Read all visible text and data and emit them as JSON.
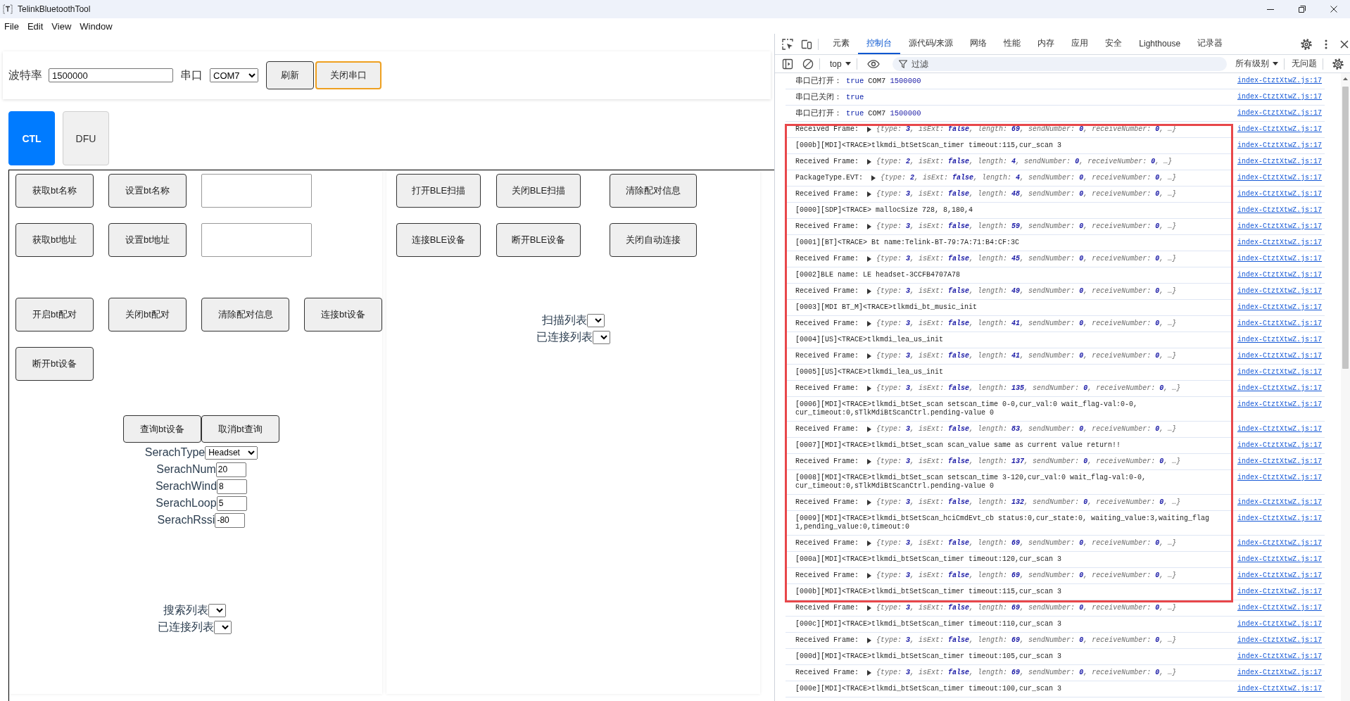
{
  "window": {
    "title": "TelinkBluetoothTool"
  },
  "menu": [
    "File",
    "Edit",
    "View",
    "Window"
  ],
  "serial_bar": {
    "baud_label": "波特率",
    "baud_value": "1500000",
    "port_label": "串口",
    "port_value": "COM7",
    "buttons": [
      {
        "label": "刷新",
        "focused": false
      },
      {
        "label": "关闭串口",
        "focused": true
      }
    ]
  },
  "tabs": [
    {
      "label": "CTL",
      "selected": true
    },
    {
      "label": "DFU",
      "selected": false
    }
  ],
  "bt_panel": {
    "rows": [
      [
        {
          "kind": "button",
          "label": "获取bt名称"
        },
        {
          "kind": "button",
          "label": "设置bt名称"
        },
        {
          "kind": "input"
        }
      ],
      [
        {
          "kind": "button",
          "label": "获取bt地址"
        },
        {
          "kind": "button",
          "label": "设置bt地址"
        },
        {
          "kind": "input"
        }
      ],
      [
        {
          "kind": "button",
          "label": "开启bt配对"
        },
        {
          "kind": "button",
          "label": "关闭bt配对"
        },
        {
          "kind": "button",
          "label": "清除配对信息"
        },
        {
          "kind": "button",
          "label": "连接bt设备"
        }
      ],
      [
        {
          "kind": "button",
          "label": "断开bt设备"
        }
      ]
    ],
    "query_buttons": [
      "查询bt设备",
      "取消bt查询"
    ],
    "search_params": [
      {
        "kind": "select",
        "label": "SerachType",
        "value": "Headset"
      },
      {
        "kind": "input",
        "label": "SerachNum",
        "value": "20"
      },
      {
        "kind": "input",
        "label": "SerachWind",
        "value": "8"
      },
      {
        "kind": "input",
        "label": "SerachLoop",
        "value": "5"
      },
      {
        "kind": "input",
        "label": "SerachRssi",
        "value": "-80"
      }
    ],
    "lists": [
      {
        "label": "搜索列表"
      },
      {
        "label": "已连接列表"
      }
    ]
  },
  "ble_panel": {
    "rows": [
      [
        "打开BLE扫描",
        "关闭BLE扫描",
        "清除配对信息"
      ],
      [
        "连接BLE设备",
        "断开BLE设备",
        "关闭自动连接"
      ]
    ],
    "lists": [
      {
        "label": "扫描列表"
      },
      {
        "label": "已连接列表"
      }
    ]
  },
  "devtools": {
    "tabs": [
      {
        "label": "元素",
        "selected": false
      },
      {
        "label": "控制台",
        "selected": true
      },
      {
        "label": "源代码/来源",
        "selected": false
      },
      {
        "label": "网络",
        "selected": false
      },
      {
        "label": "性能",
        "selected": false
      },
      {
        "label": "内存",
        "selected": false
      },
      {
        "label": "应用",
        "selected": false
      },
      {
        "label": "安全",
        "selected": false
      },
      {
        "label": "Lighthouse",
        "selected": false
      },
      {
        "label": "记录器",
        "selected": false
      }
    ],
    "context": "top",
    "filter": {
      "placeholder": "过滤"
    },
    "levels": "所有级别",
    "issues": "无问题",
    "console": {
      "groups": [
        {
          "outlined": false,
          "messages": [
            {
              "kind": "args",
              "args": [
                {
                  "kind": "string",
                  "text": "串口已打开："
                },
                {
                  "kind": "boolean",
                  "text": "true"
                },
                {
                  "kind": "string",
                  "text": "COM7"
                },
                {
                  "kind": "number",
                  "text": "1500000"
                }
              ],
              "source": "index-CtztXtwZ.js:17"
            },
            {
              "kind": "args",
              "args": [
                {
                  "kind": "string",
                  "text": "串口已关闭："
                },
                {
                  "kind": "boolean",
                  "text": "true"
                }
              ],
              "source": "index-CtztXtwZ.js:17"
            },
            {
              "kind": "args",
              "args": [
                {
                  "kind": "string",
                  "text": "串口已打开："
                },
                {
                  "kind": "boolean",
                  "text": "true"
                },
                {
                  "kind": "string",
                  "text": "COM7"
                },
                {
                  "kind": "number",
                  "text": "1500000"
                }
              ],
              "source": "index-CtztXtwZ.js:17"
            }
          ]
        },
        {
          "outlined": true,
          "messages": [
            {
              "kind": "object",
              "label": "Received Frame:",
              "expanded": false,
              "preview": "{type: **3**, isExt: **false**, length: **69**, sendNumber: **0**, receiveNumber: **0**, …}",
              "source": "index-CtztXtwZ.js:17"
            },
            {
              "kind": "log",
              "text": "[000b][MDI]<TRACE>tlkmdi_btSetScan_timer timeout:115,cur_scan 3",
              "source": "index-CtztXtwZ.js:17"
            },
            {
              "kind": "object",
              "label": "Received Frame:",
              "expanded": false,
              "preview": "{type: **2**, isExt: **false**, length: **4**, sendNumber: **0**, receiveNumber: **0**, …}",
              "source": "index-CtztXtwZ.js:17"
            },
            {
              "kind": "object",
              "label": "PackageType.EVT:",
              "expanded": false,
              "preview": "{type: **2**, isExt: **false**, length: **4**, sendNumber: **0**, receiveNumber: **0**, …}",
              "source": "index-CtztXtwZ.js:17"
            },
            {
              "kind": "object",
              "label": "Received Frame:",
              "expanded": false,
              "preview": "{type: **3**, isExt: **false**, length: **48**, sendNumber: **0**, receiveNumber: **0**, …}",
              "source": "index-CtztXtwZ.js:17"
            },
            {
              "kind": "log",
              "text": "[0000][SDP]<TRACE> mallocSize 728, 8,180,4",
              "source": "index-CtztXtwZ.js:17"
            },
            {
              "kind": "object",
              "label": "Received Frame:",
              "expanded": false,
              "preview": "{type: **3**, isExt: **false**, length: **59**, sendNumber: **0**, receiveNumber: **0**, …}",
              "source": "index-CtztXtwZ.js:17"
            },
            {
              "kind": "log",
              "text": "[0001][BT]<TRACE> Bt name:Telink-BT-79:7A:71:B4:CF:3C",
              "source": "index-CtztXtwZ.js:17"
            },
            {
              "kind": "object",
              "label": "Received Frame:",
              "expanded": false,
              "preview": "{type: **3**, isExt: **false**, length: **45**, sendNumber: **0**, receiveNumber: **0**, …}",
              "source": "index-CtztXtwZ.js:17"
            },
            {
              "kind": "log",
              "text": "[0002]BLE name: LE headset-3CCFB4707A78",
              "source": "index-CtztXtwZ.js:17"
            },
            {
              "kind": "object",
              "label": "Received Frame:",
              "expanded": false,
              "preview": "{type: **3**, isExt: **false**, length: **49**, sendNumber: **0**, receiveNumber: **0**, …}",
              "source": "index-CtztXtwZ.js:17"
            },
            {
              "kind": "log",
              "text": "[0003][MDI BT_M]<TRACE>tlkmdi_bt_music_init",
              "source": "index-CtztXtwZ.js:17"
            },
            {
              "kind": "object",
              "label": "Received Frame:",
              "expanded": false,
              "preview": "{type: **3**, isExt: **false**, length: **41**, sendNumber: **0**, receiveNumber: **0**, …}",
              "source": "index-CtztXtwZ.js:17"
            },
            {
              "kind": "log",
              "text": "[0004][US]<TRACE>tlkmdi_lea_us_init",
              "source": "index-CtztXtwZ.js:17"
            },
            {
              "kind": "object",
              "label": "Received Frame:",
              "expanded": false,
              "preview": "{type: **3**, isExt: **false**, length: **41**, sendNumber: **0**, receiveNumber: **0**, …}",
              "source": "index-CtztXtwZ.js:17"
            },
            {
              "kind": "log",
              "text": "[0005][US]<TRACE>tlkmdi_lea_us_init",
              "source": "index-CtztXtwZ.js:17"
            },
            {
              "kind": "object",
              "label": "Received Frame:",
              "expanded": false,
              "preview": "{type: **3**, isExt: **false**, length: **135**, sendNumber: **0**, receiveNumber: **0**, …}",
              "source": "index-CtztXtwZ.js:17"
            },
            {
              "kind": "log",
              "text": "[0006][MDI]<TRACE>tlkmdi_btSet_scan setscan_time 0-0,cur_val:0 wait_flag-val:0-0,\ncur_timeout:0,sTlkMdiBtScanCtrl.pending-value 0",
              "source": "index-CtztXtwZ.js:17"
            },
            {
              "kind": "object",
              "label": "Received Frame:",
              "expanded": false,
              "preview": "{type: **3**, isExt: **false**, length: **83**, sendNumber: **0**, receiveNumber: **0**, …}",
              "source": "index-CtztXtwZ.js:17"
            },
            {
              "kind": "log",
              "text": "[0007][MDI]<TRACE>tlkmdi_btSet_scan scan_value same as current value return!!",
              "source": "index-CtztXtwZ.js:17"
            },
            {
              "kind": "object",
              "label": "Received Frame:",
              "expanded": false,
              "preview": "{type: **3**, isExt: **false**, length: **137**, sendNumber: **0**, receiveNumber: **0**, …}",
              "source": "index-CtztXtwZ.js:17"
            },
            {
              "kind": "log",
              "text": "[0008][MDI]<TRACE>tlkmdi_btSet_scan setscan_time 3-120,cur_val:0 wait_flag-val:0-0,\ncur_timeout:0,sTlkMdiBtScanCtrl.pending-value 0",
              "source": "index-CtztXtwZ.js:17"
            },
            {
              "kind": "object",
              "label": "Received Frame:",
              "expanded": false,
              "preview": "{type: **3**, isExt: **false**, length: **132**, sendNumber: **0**, receiveNumber: **0**, …}",
              "source": "index-CtztXtwZ.js:17"
            },
            {
              "kind": "log",
              "text": "[0009][MDI]<TRACE>tlkmdi_btSetScan_hciCmdEvt_cb status:0,cur_state:0, waiting_value:3,waiting_flag\n1,pending_value:0,timeout:0",
              "source": "index-CtztXtwZ.js:17"
            },
            {
              "kind": "object",
              "label": "Received Frame:",
              "expanded": false,
              "preview": "{type: **3**, isExt: **false**, length: **69**, sendNumber: **0**, receiveNumber: **0**, …}",
              "source": "index-CtztXtwZ.js:17"
            },
            {
              "kind": "log",
              "text": "[000a][MDI]<TRACE>tlkmdi_btSetScan_timer timeout:120,cur_scan 3",
              "source": "index-CtztXtwZ.js:17"
            },
            {
              "kind": "object",
              "label": "Received Frame:",
              "expanded": false,
              "preview": "{type: **3**, isExt: **false**, length: **69**, sendNumber: **0**, receiveNumber: **0**, …}",
              "source": "index-CtztXtwZ.js:17"
            },
            {
              "kind": "log",
              "text": "[000b][MDI]<TRACE>tlkmdi_btSetScan_timer timeout:115,cur_scan 3",
              "source": "index-CtztXtwZ.js:17"
            }
          ]
        },
        {
          "outlined": false,
          "messages": [
            {
              "kind": "object",
              "label": "Received Frame:",
              "expanded": false,
              "preview": "{type: **3**, isExt: **false**, length: **69**, sendNumber: **0**, receiveNumber: **0**, …}",
              "source": "index-CtztXtwZ.js:17"
            },
            {
              "kind": "log",
              "text": "[000c][MDI]<TRACE>tlkmdi_btSetScan_timer timeout:110,cur_scan 3",
              "source": "index-CtztXtwZ.js:17"
            },
            {
              "kind": "object",
              "label": "Received Frame:",
              "expanded": false,
              "preview": "{type: **3**, isExt: **false**, length: **69**, sendNumber: **0**, receiveNumber: **0**, …}",
              "source": "index-CtztXtwZ.js:17"
            },
            {
              "kind": "log",
              "text": "[000d][MDI]<TRACE>tlkmdi_btSetScan_timer timeout:105,cur_scan 3",
              "source": "index-CtztXtwZ.js:17"
            },
            {
              "kind": "object",
              "label": "Received Frame:",
              "expanded": false,
              "preview": "{type: **3**, isExt: **false**, length: **69**, sendNumber: **0**, receiveNumber: **0**, …}",
              "source": "index-CtztXtwZ.js:17"
            },
            {
              "kind": "log",
              "text": "[000e][MDI]<TRACE>tlkmdi_btSetScan_timer timeout:100,cur_scan 3",
              "source": "index-CtztXtwZ.js:17"
            }
          ]
        }
      ]
    }
  }
}
